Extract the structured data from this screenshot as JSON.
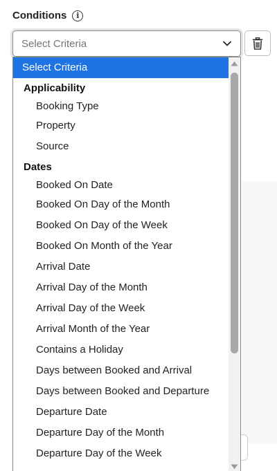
{
  "conditions": {
    "title": "Conditions",
    "info_icon": "info-icon"
  },
  "select": {
    "placeholder": "Select Criteria",
    "chevron_icon": "chevron-down-icon"
  },
  "trash_button": {
    "icon": "trash-icon"
  },
  "dropdown": {
    "selected": "Select Criteria",
    "groups": [
      {
        "label": "Applicability",
        "options": [
          "Booking Type",
          "Property",
          "Source"
        ]
      },
      {
        "label": "Dates",
        "options": [
          "Booked On Date",
          "Booked On Day of the Month",
          "Booked On Day of the Week",
          "Booked On Month of the Year",
          "Arrival Date",
          "Arrival Day of the Month",
          "Arrival Day of the Week",
          "Arrival Month of the Year",
          "Contains a Holiday",
          "Days between Booked and Arrival",
          "Days between Booked and Departure",
          "Departure Date",
          "Departure Day of the Month",
          "Departure Day of the Week"
        ]
      }
    ]
  },
  "colors": {
    "highlight": "#1e74e3",
    "border": "#8a8a8a",
    "scroll_thumb": "#a8a8a8"
  }
}
